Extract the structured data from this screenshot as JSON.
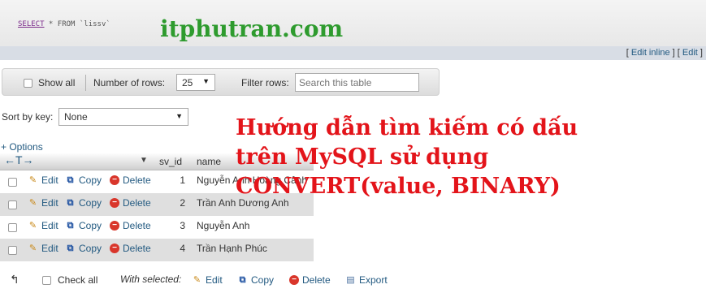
{
  "sql": {
    "keyword": "SELECT",
    "rest": " * FROM `lissv`",
    "edit_links": {
      "edit_inline": "Edit inline",
      "edit": "Edit"
    }
  },
  "watermark": "itphutran.com",
  "navigation": {
    "show_all_label": "Show all",
    "rows_label": "Number of rows:",
    "rows_value": "25",
    "filter_label": "Filter rows:",
    "filter_placeholder": "Search this table"
  },
  "sort": {
    "label": "Sort by key:",
    "value": "None"
  },
  "table": {
    "options_label": "+ Options",
    "columns": [
      "sv_id",
      "name"
    ],
    "action_labels": {
      "edit": "Edit",
      "copy": "Copy",
      "delete": "Delete"
    },
    "rows": [
      {
        "id": "1",
        "name": "Nguyễn Anh Hoàng Cảnh"
      },
      {
        "id": "2",
        "name": "Trần Anh Dương Anh"
      },
      {
        "id": "3",
        "name": "Nguyễn Anh"
      },
      {
        "id": "4",
        "name": "Trần Hạnh Phúc"
      }
    ]
  },
  "bottom": {
    "check_all": "Check all",
    "with_selected": "With selected:",
    "edit": "Edit",
    "copy": "Copy",
    "delete": "Delete",
    "export": "Export"
  },
  "overlay": {
    "line1": "Hướng dẫn tìm kiếm có dấu",
    "line2": "trên MySQL sử dụng",
    "line3": "CONVERT(value, BINARY)"
  },
  "colors": {
    "link": "#235a81",
    "watermark": "#2e9b2e",
    "overlay": "#e3141a",
    "row_stripe": "#dfdfdf"
  }
}
